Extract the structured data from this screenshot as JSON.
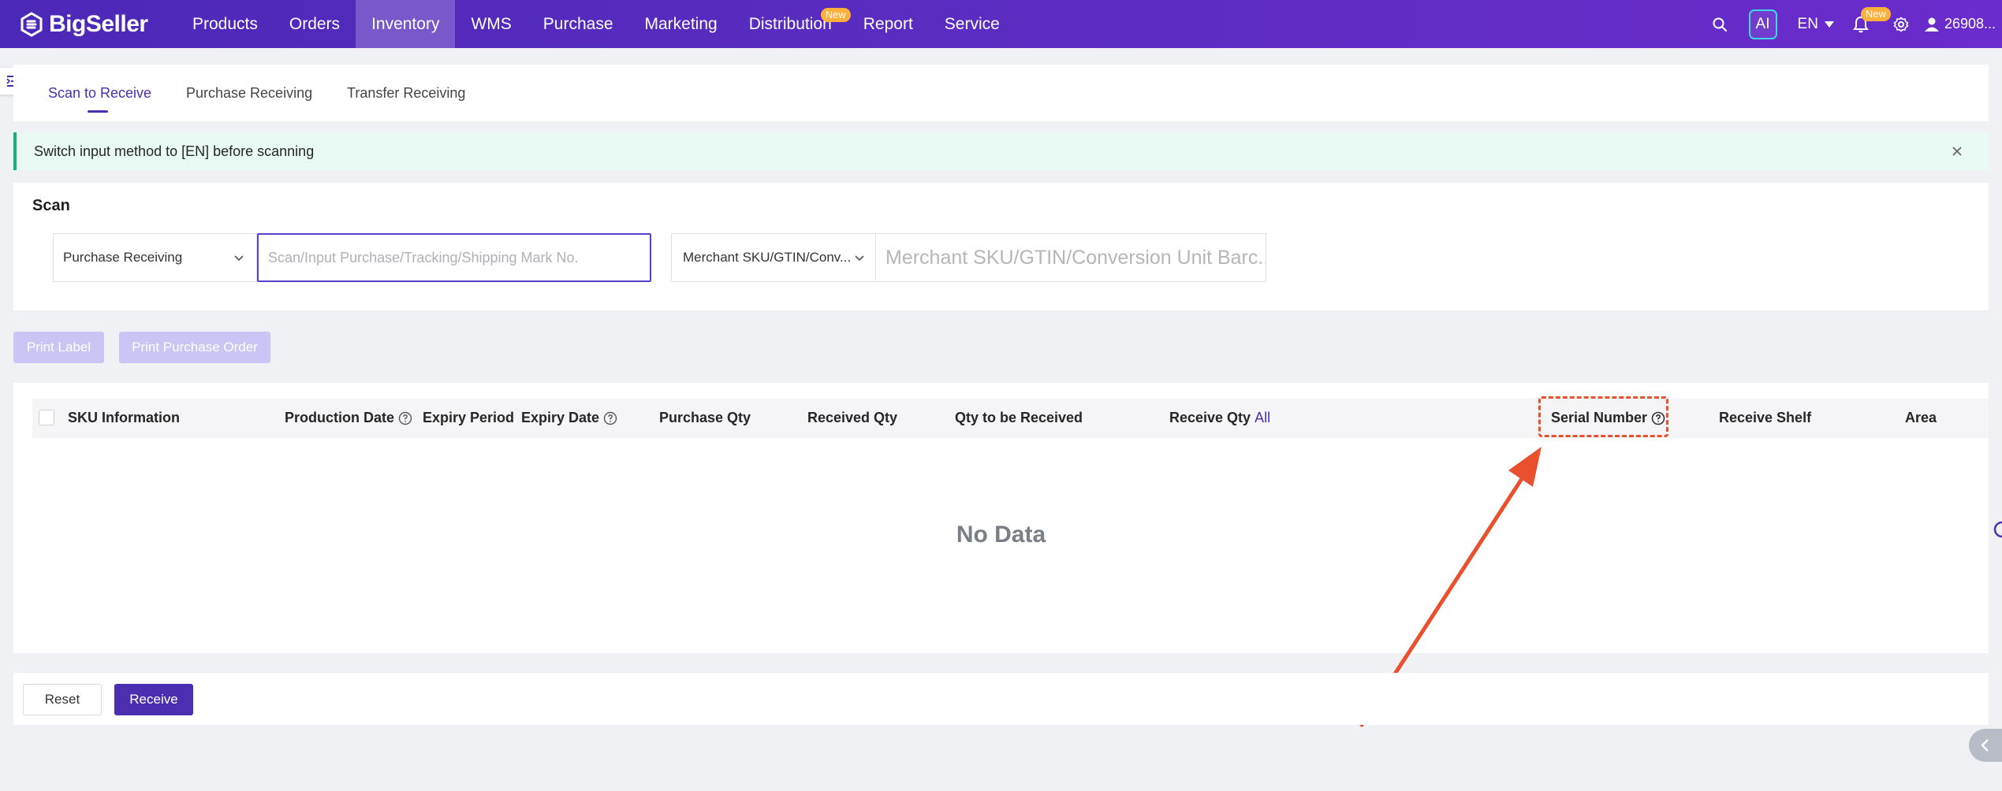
{
  "brand": {
    "name": "BigSeller"
  },
  "nav": {
    "items": [
      {
        "label": "Products"
      },
      {
        "label": "Orders"
      },
      {
        "label": "Inventory",
        "active": true
      },
      {
        "label": "WMS"
      },
      {
        "label": "Purchase"
      },
      {
        "label": "Marketing"
      },
      {
        "label": "Distribution",
        "badge": "New"
      },
      {
        "label": "Report"
      },
      {
        "label": "Service"
      }
    ],
    "ai_label": "AI",
    "language": "EN",
    "notification_badge": "New",
    "user": "26908..."
  },
  "tabs": [
    {
      "label": "Scan to Receive",
      "active": true
    },
    {
      "label": "Purchase Receiving"
    },
    {
      "label": "Transfer Receiving"
    }
  ],
  "alert": {
    "text": "Switch input method to [EN] before scanning"
  },
  "scan": {
    "title": "Scan",
    "mode_select": "Purchase Receiving",
    "order_input_placeholder": "Scan/Input Purchase/Tracking/Shipping Mark No.",
    "sku_select": "Merchant SKU/GTIN/Conv...",
    "sku_input_placeholder": "Merchant SKU/GTIN/Conversion Unit Barc..."
  },
  "actions": {
    "print_label": "Print Label",
    "print_purchase_order": "Print Purchase Order"
  },
  "table": {
    "columns": {
      "sku_info": "SKU Information",
      "production_date": "Production Date",
      "expiry_period": "Expiry Period",
      "expiry_date": "Expiry Date",
      "purchase_qty": "Purchase Qty",
      "received_qty": "Received Qty",
      "qty_to_receive": "Qty to be Received",
      "receive_qty": "Receive Qty",
      "receive_qty_all": "All",
      "serial_number": "Serial Number",
      "receive_shelf": "Receive Shelf",
      "area": "Area"
    },
    "empty_text": "No Data"
  },
  "footer": {
    "reset": "Reset",
    "receive": "Receive"
  },
  "colors": {
    "nav_gradient_start": "#4c28b8",
    "nav_gradient_end": "#6a2ccc",
    "primary": "#4b2fb0",
    "highlight": "#e8502e",
    "alert_bg": "#e8faf3",
    "alert_border": "#18b07a"
  }
}
